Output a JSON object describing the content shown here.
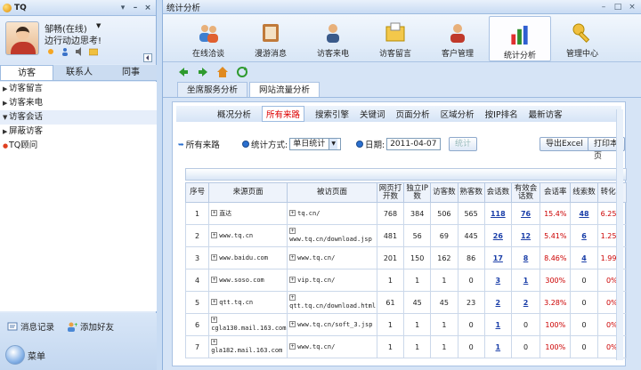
{
  "left": {
    "app_title": "TQ",
    "user_name": "邹畅(在线)",
    "user_message": "边行动边思考!",
    "tabs": [
      "访客",
      "联系人",
      "同事"
    ],
    "list_items": [
      {
        "label": "访客留言",
        "expanded": false
      },
      {
        "label": "访客来电",
        "expanded": false
      },
      {
        "label": "访客会话",
        "expanded": true
      },
      {
        "label": "屏蔽访客",
        "expanded": false
      },
      {
        "label": "TQ顾问",
        "expanded": false
      }
    ],
    "msg_record": "消息记录",
    "add_friend": "添加好友",
    "menu": "菜单"
  },
  "right": {
    "title": "统计分析",
    "toolbar": [
      "在线洽谈",
      "漫游消息",
      "访客来电",
      "访客留言",
      "客户管理",
      "统计分析",
      "管理中心"
    ],
    "subtabs": [
      "坐席服务分析",
      "网站流量分析"
    ],
    "content_menu": [
      "概况分析",
      "所有来路",
      "搜索引擎",
      "关键词",
      "页面分析",
      "区域分析",
      "按IP排名",
      "最新访客"
    ],
    "filter": {
      "label_all": "所有来路",
      "stat_label": "统计方式:",
      "stat_value": "单日统计",
      "date_label": "日期:",
      "date_value": "2011-04-07",
      "stat_button": "统计",
      "export_button": "导出Excel",
      "print_button": "打印本页"
    },
    "table": {
      "headers": [
        "序号",
        "来源页面",
        "被访页面",
        "网页打开数",
        "独立IP数",
        "访客数",
        "熟客数",
        "会话数",
        "有效会话数",
        "会话率",
        "线索数",
        "转化率"
      ],
      "rows": [
        {
          "no": "1",
          "src": "直达",
          "page": "tq.cn/",
          "open": "768",
          "ip": "384",
          "visitors": "506",
          "regulars": "565",
          "sessions": "118",
          "valid": "76",
          "rate": "15.4%",
          "leads": "48",
          "conv": "6.25%"
        },
        {
          "no": "2",
          "src": "www.tq.cn",
          "page": "www.tq.cn/download.jsp",
          "open": "481",
          "ip": "56",
          "visitors": "69",
          "regulars": "445",
          "sessions": "26",
          "valid": "12",
          "rate": "5.41%",
          "leads": "6",
          "conv": "1.25%"
        },
        {
          "no": "3",
          "src": "www.baidu.com",
          "page": "www.tq.cn/",
          "open": "201",
          "ip": "150",
          "visitors": "162",
          "regulars": "86",
          "sessions": "17",
          "valid": "8",
          "rate": "8.46%",
          "leads": "4",
          "conv": "1.99%"
        },
        {
          "no": "4",
          "src": "www.soso.com",
          "page": "vip.tq.cn/",
          "open": "1",
          "ip": "1",
          "visitors": "1",
          "regulars": "0",
          "sessions": "3",
          "valid": "1",
          "rate": "300%",
          "leads": "0",
          "conv": "0%"
        },
        {
          "no": "5",
          "src": "qtt.tq.cn",
          "page": "qtt.tq.cn/download.html",
          "open": "61",
          "ip": "45",
          "visitors": "45",
          "regulars": "23",
          "sessions": "2",
          "valid": "2",
          "rate": "3.28%",
          "leads": "0",
          "conv": "0%"
        },
        {
          "no": "6",
          "src": "cgla130.mail.163.com",
          "page": "www.tq.cn/soft_3.jsp",
          "open": "1",
          "ip": "1",
          "visitors": "1",
          "regulars": "0",
          "sessions": "1",
          "valid": "0",
          "rate": "100%",
          "leads": "0",
          "conv": "0%"
        },
        {
          "no": "7",
          "src": "gla182.mail.163.com",
          "page": "www.tq.cn/",
          "open": "1",
          "ip": "1",
          "visitors": "1",
          "regulars": "0",
          "sessions": "1",
          "valid": "0",
          "rate": "100%",
          "leads": "0",
          "conv": "0%"
        }
      ]
    }
  }
}
